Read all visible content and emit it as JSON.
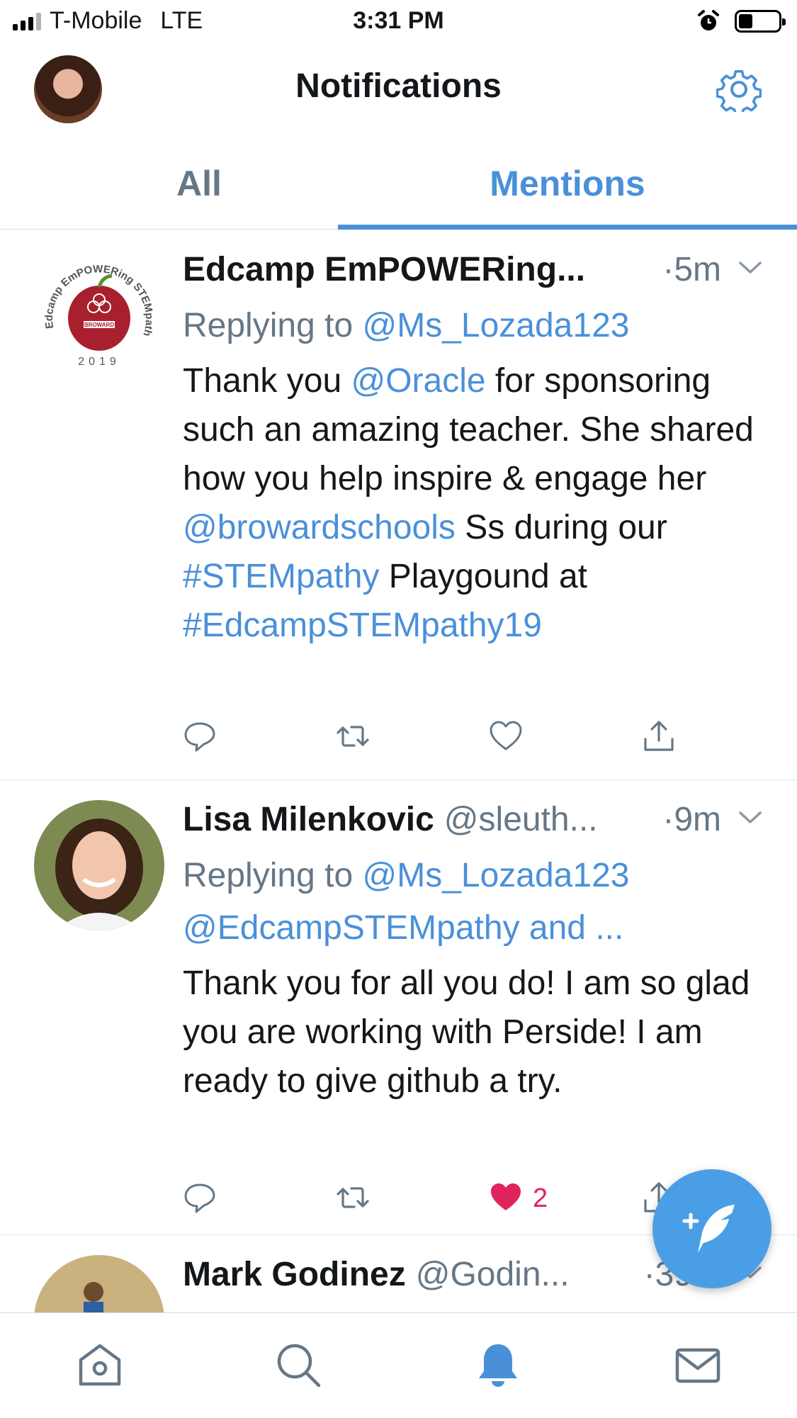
{
  "status_bar": {
    "carrier": "T-Mobile",
    "network": "LTE",
    "time": "3:31 PM",
    "battery_level": 0.35
  },
  "header": {
    "title": "Notifications"
  },
  "tabs": [
    {
      "label": "All",
      "selected": false
    },
    {
      "label": "Mentions",
      "selected": true
    }
  ],
  "tweets": [
    {
      "author": "Edcamp EmPOWERing...",
      "handle": "",
      "time": "·5m",
      "replying_prefix": "Replying to ",
      "replying_to": "@Ms_Lozada123",
      "replying_to_more": "",
      "text": {
        "p1": "Thank you ",
        "m1": "@Oracle",
        "p2": " for sponsoring such an amazing teacher. She shared how you help inspire & engage her ",
        "m2": "@browardschools",
        "p3": " Ss during our ",
        "m3": "#STEMpathy",
        "p4": " Playgound at ",
        "m4": "#EdcampSTEMpathy19"
      },
      "likes": "",
      "logo": {
        "top_text": "Edcamp EmPOWERing STEMpathy",
        "center_text": "BROWARD",
        "year": "2019"
      }
    },
    {
      "author": "Lisa Milenkovic",
      "handle": "@sleuth...",
      "time": "·9m",
      "replying_prefix": "Replying to ",
      "replying_to": "@Ms_Lozada123",
      "replying_to_more": "@EdcampSTEMpathy and ...",
      "text": "Thank you for all you do! I am so glad you are working with Perside! I am ready to give github a try.",
      "likes": "2"
    },
    {
      "author": "Mark Godinez",
      "handle": "@Godin...",
      "time": "·39m"
    }
  ],
  "icons": {
    "gear": "gear-icon",
    "reply": "reply-icon",
    "retweet": "retweet-icon",
    "like": "heart-icon",
    "share": "share-icon",
    "compose": "compose-icon",
    "home": "home-icon",
    "search": "search-icon",
    "notifications": "bell-icon",
    "messages": "mail-icon"
  },
  "colors": {
    "accent": "#4a90d9",
    "secondary_text": "#657786",
    "like": "#e0245e",
    "fab": "#4a9ee6"
  }
}
